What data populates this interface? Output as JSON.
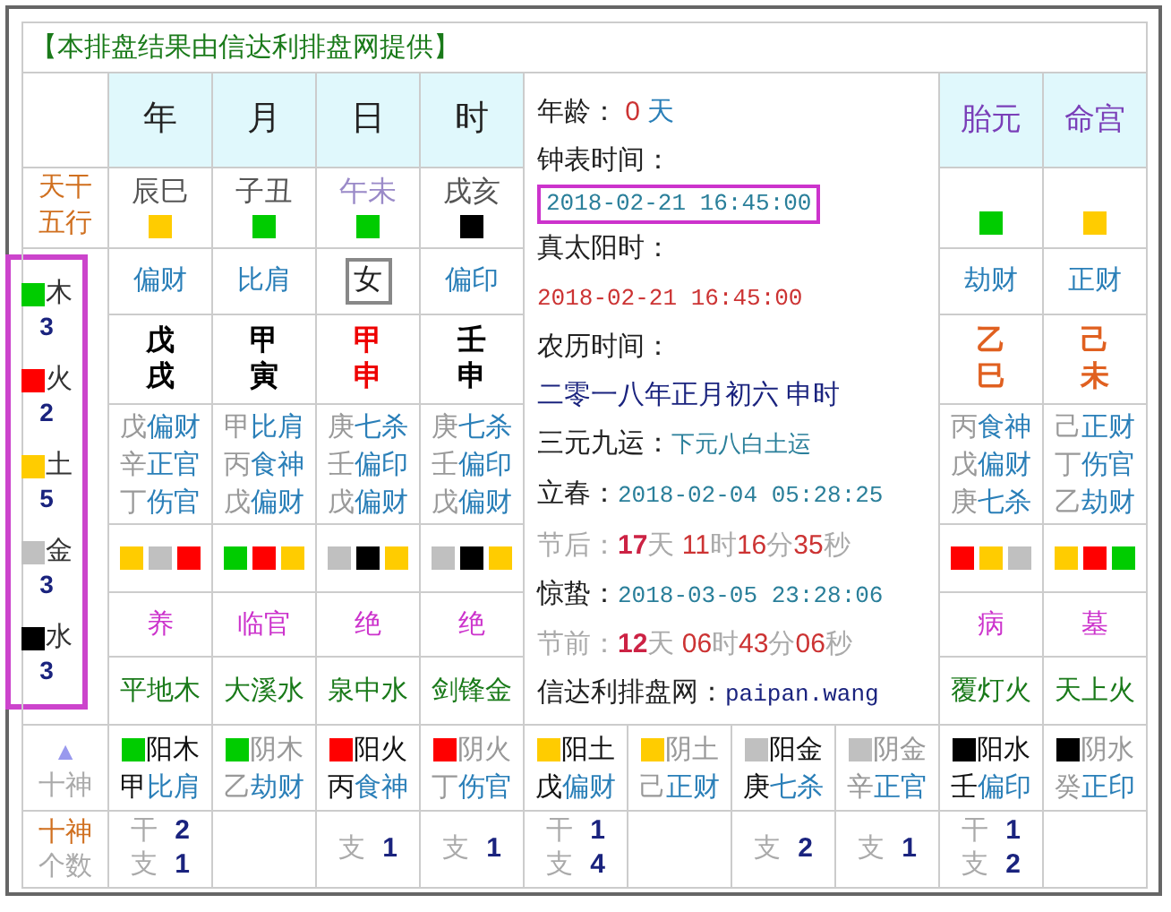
{
  "title": "【本排盘结果由信达利排盘网提供】",
  "pillars": [
    {
      "name": "年",
      "branches": "辰巳",
      "highlighted": false,
      "element_square": {
        "color": "#ffcc00"
      },
      "god": "偏财",
      "kind": "text",
      "stem": "戊",
      "branch": "戌",
      "color": "#000000",
      "hidden": [
        {
          "stem": "戊",
          "god": "偏财"
        },
        {
          "stem": "辛",
          "god": "正官"
        },
        {
          "stem": "丁",
          "god": "伤官"
        }
      ],
      "squares": [
        {
          "color": "#ffcc00"
        },
        {
          "color": "#c0c0c0"
        },
        {
          "color": "#ff0000"
        }
      ],
      "stage": "养",
      "nayin": "平地木"
    },
    {
      "name": "月",
      "branches": "子丑",
      "highlighted": false,
      "element_square": {
        "color": "#00cc00"
      },
      "god": "比肩",
      "kind": "text",
      "stem": "甲",
      "branch": "寅",
      "color": "#000000",
      "hidden": [
        {
          "stem": "甲",
          "god": "比肩"
        },
        {
          "stem": "丙",
          "god": "食神"
        },
        {
          "stem": "戊",
          "god": "偏财"
        }
      ],
      "squares": [
        {
          "color": "#00cc00"
        },
        {
          "color": "#ff0000"
        },
        {
          "color": "#ffcc00"
        }
      ],
      "stage": "临官",
      "nayin": "大溪水"
    },
    {
      "name": "日",
      "branches": "午未",
      "highlighted": true,
      "element_square": {
        "color": "#00cc00"
      },
      "god": "女",
      "kind": "gender",
      "stem": "甲",
      "branch": "申",
      "color": "#ee0000",
      "hidden": [
        {
          "stem": "庚",
          "god": "七杀"
        },
        {
          "stem": "壬",
          "god": "偏印"
        },
        {
          "stem": "戊",
          "god": "偏财"
        }
      ],
      "squares": [
        {
          "color": "#c0c0c0"
        },
        {
          "color": "#000000"
        },
        {
          "color": "#ffcc00"
        }
      ],
      "stage": "绝",
      "nayin": "泉中水"
    },
    {
      "name": "时",
      "branches": "戌亥",
      "highlighted": false,
      "element_square": {
        "color": "#000000"
      },
      "god": "偏印",
      "kind": "text",
      "stem": "壬",
      "branch": "申",
      "color": "#000000",
      "hidden": [
        {
          "stem": "庚",
          "god": "七杀"
        },
        {
          "stem": "壬",
          "god": "偏印"
        },
        {
          "stem": "戊",
          "god": "偏财"
        }
      ],
      "squares": [
        {
          "color": "#c0c0c0"
        },
        {
          "color": "#000000"
        },
        {
          "color": "#ffcc00"
        }
      ],
      "stage": "绝",
      "nayin": "剑锋金"
    }
  ],
  "extra_pillars": [
    {
      "name": "胎元",
      "element_square": {
        "color": "#00cc00"
      },
      "god": "劫财",
      "stem": "乙",
      "branch": "巳",
      "color": "#e06020",
      "hidden": [
        {
          "stem": "丙",
          "god": "食神"
        },
        {
          "stem": "戊",
          "god": "偏财"
        },
        {
          "stem": "庚",
          "god": "七杀"
        }
      ],
      "squares": [
        {
          "color": "#ff0000"
        },
        {
          "color": "#ffcc00"
        },
        {
          "color": "#c0c0c0"
        }
      ],
      "stage": "病",
      "nayin": "覆灯火"
    },
    {
      "name": "命宫",
      "element_square": {
        "color": "#ffcc00"
      },
      "god": "正财",
      "stem": "己",
      "branch": "未",
      "color": "#e06020",
      "hidden": [
        {
          "stem": "己",
          "god": "正财"
        },
        {
          "stem": "丁",
          "god": "伤官"
        },
        {
          "stem": "乙",
          "god": "劫财"
        }
      ],
      "squares": [
        {
          "color": "#ffcc00"
        },
        {
          "color": "#ff0000"
        },
        {
          "color": "#00cc00"
        }
      ],
      "stage": "墓",
      "nayin": "天上火"
    }
  ],
  "row_label": "天干五行",
  "elements": [
    {
      "name": "木",
      "count": "3",
      "color": "#00cc00"
    },
    {
      "name": "火",
      "count": "2",
      "color": "#ff0000"
    },
    {
      "name": "土",
      "count": "5",
      "color": "#ffcc00"
    },
    {
      "name": "金",
      "count": "3",
      "color": "#c0c0c0"
    },
    {
      "name": "水",
      "count": "3",
      "color": "#000000"
    }
  ],
  "info": [
    {
      "kind": "age",
      "label": "年龄：",
      "value": "0",
      "unit": "天"
    },
    {
      "kind": "heading",
      "text": "钟表时间："
    },
    {
      "kind": "boxed",
      "text": "2018-02-21 16:45:00"
    },
    {
      "kind": "heading",
      "text": "真太阳时："
    },
    {
      "kind": "red",
      "text": "2018-02-21 16:45:00"
    },
    {
      "kind": "heading",
      "text": "农历时间："
    },
    {
      "kind": "lunar",
      "text": "二零一八年正月初六 申时"
    },
    {
      "kind": "term",
      "label": "三元九运：",
      "value": "下元八白土运"
    },
    {
      "kind": "term",
      "label": "立春：",
      "value": "2018-02-04 05:28:25"
    },
    {
      "kind": "interval",
      "label": "节后：",
      "parts": [
        {
          "num": "17",
          "unit": "天"
        },
        {
          "num": "11",
          "unit": "时"
        },
        {
          "num": "16",
          "unit": "分"
        },
        {
          "num": "35",
          "unit": "秒"
        }
      ]
    },
    {
      "kind": "term",
      "label": "惊蛰：",
      "value": "2018-03-05 23:28:06"
    },
    {
      "kind": "interval",
      "label": "节前：",
      "parts": [
        {
          "num": "12",
          "unit": "天"
        },
        {
          "num": "06",
          "unit": "时"
        },
        {
          "num": "43",
          "unit": "分"
        },
        {
          "num": "06",
          "unit": "秒"
        }
      ]
    },
    {
      "kind": "site",
      "label": "信达利排盘网：",
      "value": "paipan.wang"
    }
  ],
  "gods_label": {
    "mark": "▲",
    "text": "十神"
  },
  "gods": [
    {
      "element": "阳木",
      "yang": true,
      "color": "#00cc00",
      "stem": "甲",
      "god": "比肩",
      "counts": [
        {
          "label": "干",
          "value": "2"
        },
        {
          "label": "支",
          "value": "1"
        }
      ]
    },
    {
      "element": "阴木",
      "yang": false,
      "color": "#00cc00",
      "stem": "乙",
      "god": "劫财"
    },
    {
      "element": "阳火",
      "yang": true,
      "color": "#ff0000",
      "stem": "丙",
      "god": "食神",
      "counts": [
        {
          "label": "支",
          "value": "1"
        }
      ]
    },
    {
      "element": "阴火",
      "yang": false,
      "color": "#ff0000",
      "stem": "丁",
      "god": "伤官",
      "counts": [
        {
          "label": "支",
          "value": "1"
        }
      ]
    },
    {
      "element": "阳土",
      "yang": true,
      "color": "#ffcc00",
      "stem": "戊",
      "god": "偏财",
      "counts": [
        {
          "label": "干",
          "value": "1"
        },
        {
          "label": "支",
          "value": "4"
        }
      ]
    },
    {
      "element": "阴土",
      "yang": false,
      "color": "#ffcc00",
      "stem": "己",
      "god": "正财"
    },
    {
      "element": "阳金",
      "yang": true,
      "color": "#c0c0c0",
      "stem": "庚",
      "god": "七杀",
      "counts": [
        {
          "label": "支",
          "value": "2"
        }
      ]
    },
    {
      "element": "阴金",
      "yang": false,
      "color": "#c0c0c0",
      "stem": "辛",
      "god": "正官",
      "counts": [
        {
          "label": "支",
          "value": "1"
        }
      ]
    },
    {
      "element": "阳水",
      "yang": true,
      "color": "#000000",
      "stem": "壬",
      "god": "偏印",
      "counts": [
        {
          "label": "干",
          "value": "1"
        },
        {
          "label": "支",
          "value": "2"
        }
      ]
    },
    {
      "element": "阴水",
      "yang": false,
      "color": "#000000",
      "stem": "癸",
      "god": "正印"
    }
  ],
  "counts_label": [
    "十神",
    "个数"
  ]
}
